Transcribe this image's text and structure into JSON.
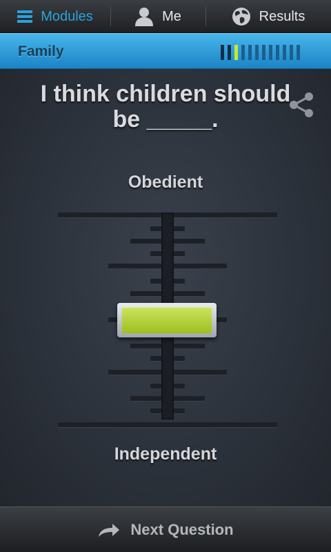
{
  "nav": {
    "modules_label": "Modules",
    "me_label": "Me",
    "results_label": "Results",
    "active_tab": "Modules"
  },
  "category": {
    "title": "Family",
    "progress": {
      "current": 3,
      "total": 12
    }
  },
  "question": {
    "text": "I think children should be _____."
  },
  "scale": {
    "top_label": "Obedient",
    "bottom_label": "Independent",
    "value_from_top": 0.5
  },
  "footer": {
    "next_label": "Next Question"
  },
  "colors": {
    "accent_blue": "#2ba3dc",
    "progress_current": "#c6ea2a",
    "handle_green": "#b3d43a"
  },
  "icons": {
    "modules": "menu-icon",
    "me": "person-icon",
    "results": "globe-icon",
    "share": "share-icon",
    "next": "arrow-right-icon"
  }
}
